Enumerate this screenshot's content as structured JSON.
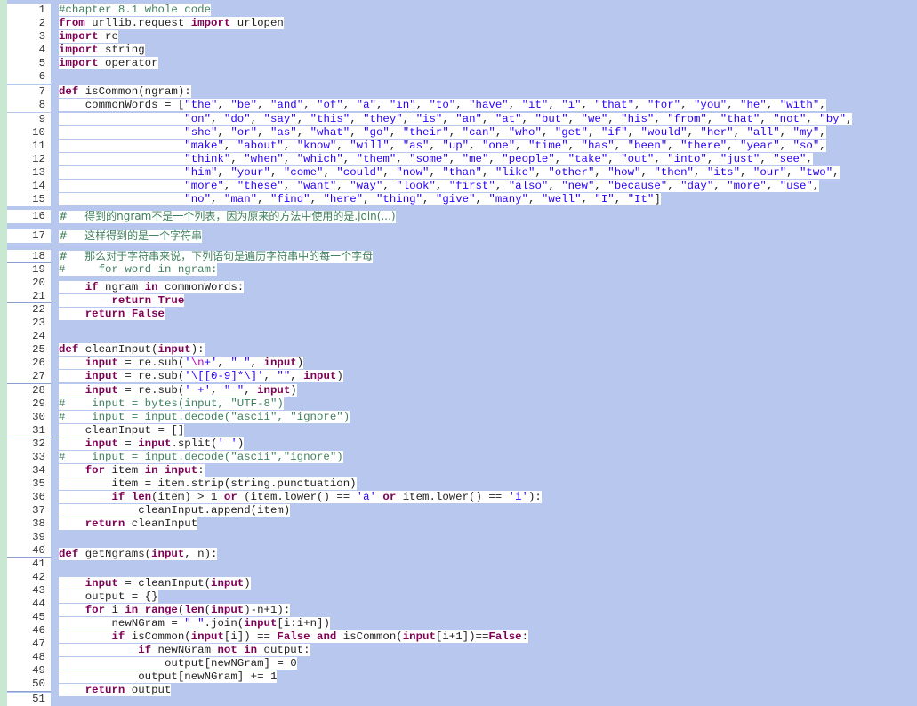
{
  "editor": {
    "lines": [
      {
        "n": "1",
        "code": "#chapter 8.1 whole code"
      },
      {
        "n": "2",
        "code": "from urllib.request import urlopen"
      },
      {
        "n": "3",
        "code": "import re"
      },
      {
        "n": "4",
        "code": "import string"
      },
      {
        "n": "5",
        "code": "import operator"
      },
      {
        "n": "6",
        "code": ""
      },
      {
        "n": "7",
        "code": "def isCommon(ngram):"
      },
      {
        "n": "8",
        "code": "    commonWords = [\"the\", \"be\", \"and\", \"of\", \"a\", \"in\", \"to\", \"have\", \"it\", \"i\", \"that\", \"for\", \"you\", \"he\", \"with\","
      },
      {
        "n": "9",
        "code": "                   \"on\", \"do\", \"say\", \"this\", \"they\", \"is\", \"an\", \"at\", \"but\", \"we\", \"his\", \"from\", \"that\", \"not\", \"by\","
      },
      {
        "n": "10",
        "code": "                   \"she\", \"or\", \"as\", \"what\", \"go\", \"their\", \"can\", \"who\", \"get\", \"if\", \"would\", \"her\", \"all\", \"my\","
      },
      {
        "n": "11",
        "code": "                   \"make\", \"about\", \"know\", \"will\", \"as\", \"up\", \"one\", \"time\", \"has\", \"been\", \"there\", \"year\", \"so\","
      },
      {
        "n": "12",
        "code": "                   \"think\", \"when\", \"which\", \"them\", \"some\", \"me\", \"people\", \"take\", \"out\", \"into\", \"just\", \"see\","
      },
      {
        "n": "13",
        "code": "                   \"him\", \"your\", \"come\", \"could\", \"now\", \"than\", \"like\", \"other\", \"how\", \"then\", \"its\", \"our\", \"two\","
      },
      {
        "n": "14",
        "code": "                   \"more\", \"these\", \"want\", \"way\", \"look\", \"first\", \"also\", \"new\", \"because\", \"day\", \"more\", \"use\","
      },
      {
        "n": "15",
        "code": "                   \"no\", \"man\", \"find\", \"here\", \"thing\", \"give\", \"many\", \"well\", \"I\", \"It\"]"
      },
      {
        "n": "16",
        "code": "#     得到的ngram不是一个列表，因为原来的方法中使用的是.join(...)"
      },
      {
        "n": "17",
        "code": "#     这样得到的是一个字符串"
      },
      {
        "n": "18",
        "code": "#     那么对于字符串来说，下列语句是遍历字符串中的每一个字母"
      },
      {
        "n": "19",
        "code": "#     for word in ngram:"
      },
      {
        "n": "20",
        "code": "    if ngram in commonWords:"
      },
      {
        "n": "21",
        "code": "        return True"
      },
      {
        "n": "22",
        "code": "    return False"
      },
      {
        "n": "23",
        "code": ""
      },
      {
        "n": "24",
        "code": ""
      },
      {
        "n": "25",
        "code": "def cleanInput(input):"
      },
      {
        "n": "26",
        "code": "    input = re.sub('\\n+', \" \", input)"
      },
      {
        "n": "27",
        "code": "    input = re.sub('\\[[0-9]*\\]', \"\", input)"
      },
      {
        "n": "28",
        "code": "    input = re.sub(' +', \" \", input)"
      },
      {
        "n": "29",
        "code": "#    input = bytes(input, \"UTF-8\")"
      },
      {
        "n": "30",
        "code": "#    input = input.decode(\"ascii\", \"ignore\")"
      },
      {
        "n": "31",
        "code": "    cleanInput = []"
      },
      {
        "n": "32",
        "code": "    input = input.split(' ')"
      },
      {
        "n": "33",
        "code": "#    input = input.decode(\"ascii\",\"ignore\")"
      },
      {
        "n": "34",
        "code": "    for item in input:"
      },
      {
        "n": "35",
        "code": "        item = item.strip(string.punctuation)"
      },
      {
        "n": "36",
        "code": "        if len(item) > 1 or (item.lower() == 'a' or item.lower() == 'i'):"
      },
      {
        "n": "37",
        "code": "            cleanInput.append(item)"
      },
      {
        "n": "38",
        "code": "    return cleanInput"
      },
      {
        "n": "39",
        "code": ""
      },
      {
        "n": "40",
        "code": "def getNgrams(input, n):"
      },
      {
        "n": "41",
        "code": ""
      },
      {
        "n": "42",
        "code": "    input = cleanInput(input)"
      },
      {
        "n": "43",
        "code": "    output = {}"
      },
      {
        "n": "44",
        "code": "    for i in range(len(input)-n+1):"
      },
      {
        "n": "45",
        "code": "        newNGram = \" \".join(input[i:i+n])"
      },
      {
        "n": "46",
        "code": "        if isCommon(input[i]) == False and isCommon(input[i+1])==False:"
      },
      {
        "n": "47",
        "code": "            if newNGram not in output:"
      },
      {
        "n": "48",
        "code": "                output[newNGram] = 0"
      },
      {
        "n": "49",
        "code": "            output[newNGram] += 1"
      },
      {
        "n": "50",
        "code": "    return output"
      },
      {
        "n": "51",
        "code": ""
      }
    ]
  }
}
